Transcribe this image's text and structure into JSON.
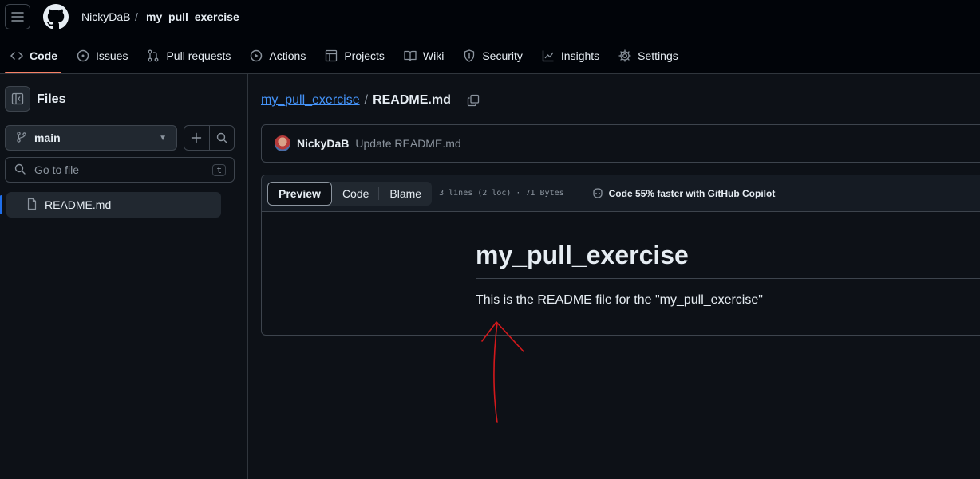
{
  "header": {
    "owner": "NickyDaB",
    "separator": "/",
    "repo": "my_pull_exercise"
  },
  "tabs": [
    {
      "label": "Code",
      "icon": "code-icon"
    },
    {
      "label": "Issues",
      "icon": "issue-icon"
    },
    {
      "label": "Pull requests",
      "icon": "pull-request-icon"
    },
    {
      "label": "Actions",
      "icon": "play-icon"
    },
    {
      "label": "Projects",
      "icon": "table-icon"
    },
    {
      "label": "Wiki",
      "icon": "book-icon"
    },
    {
      "label": "Security",
      "icon": "shield-icon"
    },
    {
      "label": "Insights",
      "icon": "graph-icon"
    },
    {
      "label": "Settings",
      "icon": "gear-icon"
    }
  ],
  "sidebar": {
    "title": "Files",
    "branch": "main",
    "search_placeholder": "Go to file",
    "search_shortcut": "t",
    "files": [
      {
        "name": "README.md"
      }
    ]
  },
  "main": {
    "path_repo": "my_pull_exercise",
    "path_sep": "/",
    "path_file": "README.md",
    "commit": {
      "author": "NickyDaB",
      "message": "Update README.md"
    },
    "view_tabs": {
      "preview": "Preview",
      "code": "Code",
      "blame": "Blame"
    },
    "file_meta": "3 lines (2 loc) · 71 Bytes",
    "copilot": "Code 55% faster with GitHub Copilot",
    "readme_title": "my_pull_exercise",
    "readme_body": "This is the README file for the \"my_pull_exercise\""
  },
  "colors": {
    "accent_tab": "#f78166",
    "link": "#4493f8",
    "annotation": "#d3191c"
  }
}
